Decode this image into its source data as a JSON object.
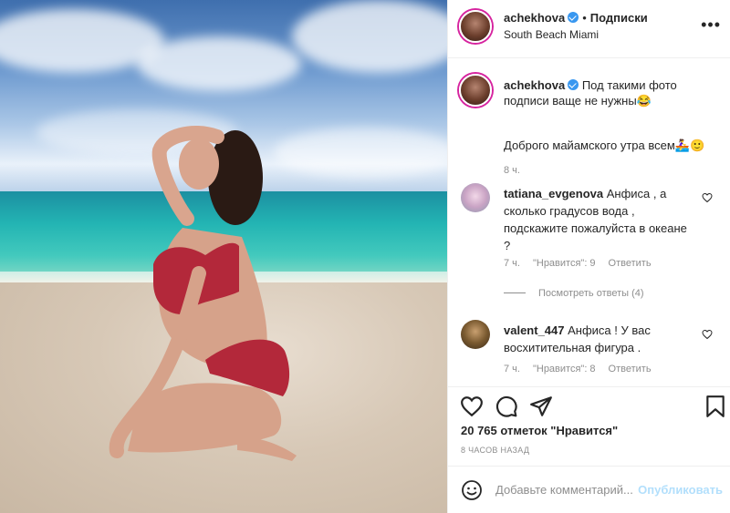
{
  "post": {
    "author": "achekhova",
    "follow_label": "Подписки",
    "dot": "•",
    "location": "South Beach Miami",
    "more_icon": "more-icon",
    "photo_alt": "beach photo"
  },
  "caption": {
    "username": "achekhova",
    "text": "Под такими фото подписи ваще не нужны😂",
    "text2": "Доброго майамского утра всем🚣‍♀️🙂",
    "time": "8 ч."
  },
  "comments": [
    {
      "username": "tatiana_evgenova",
      "text": "Анфиса , а сколько градусов вода , подскажите пожалуйста в океане ?",
      "time": "7 ч.",
      "likes": "\"Нравится\": 9",
      "reply": "Ответить",
      "view_replies": "Посмотреть ответы (4)"
    },
    {
      "username": "valent_447",
      "text": "Анфиса ! У вас восхитительная фигура .",
      "time": "7 ч.",
      "likes": "\"Нравится\": 8",
      "reply": "Ответить"
    }
  ],
  "stats": {
    "likes": "20 765 отметок \"Нравится\"",
    "ago": "8 ЧАСОВ НАЗАД"
  },
  "add_comment": {
    "placeholder": "Добавьте комментарий...",
    "publish": "Опубликовать"
  },
  "colors": {
    "verified": "#3897f0",
    "publish_disabled": "#b2dffc",
    "secondary_text": "#8e8e8e"
  }
}
